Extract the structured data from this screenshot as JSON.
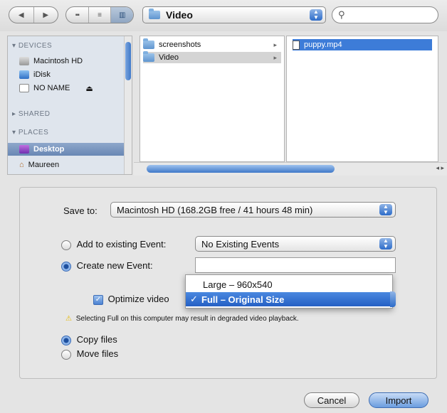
{
  "toolbar": {
    "nav": {
      "back": "◀",
      "forward": "▶"
    },
    "view_modes": [
      "icon",
      "list",
      "column"
    ],
    "location": "Video",
    "search_icon": "⚲"
  },
  "sidebar": {
    "devices_header": "DEVICES",
    "devices": [
      {
        "label": "Macintosh HD",
        "icon": "hard-drive-icon"
      },
      {
        "label": "iDisk",
        "icon": "idisk-icon"
      },
      {
        "label": "NO NAME",
        "icon": "volume-icon",
        "eject": "⏏"
      }
    ],
    "shared_header": "SHARED",
    "places_header": "PLACES",
    "places": [
      {
        "label": "Desktop",
        "icon": "desktop-icon",
        "selected": true
      },
      {
        "label": "Maureen",
        "icon": "home-icon"
      }
    ]
  },
  "browser": {
    "column1": [
      {
        "label": "screenshots",
        "arrow": "▸"
      },
      {
        "label": "Video",
        "arrow": "▸"
      }
    ],
    "column2": [
      {
        "label": "puppy.mp4"
      }
    ]
  },
  "options": {
    "save_to_label": "Save to:",
    "save_to_value": "Macintosh HD (168.2GB free / 41 hours 48 min)",
    "add_existing_label": "Add to existing Event:",
    "add_existing_value": "No Existing Events",
    "create_new_label": "Create new Event:",
    "create_new_value": "",
    "optimize_label": "Optimize video",
    "optimize_menu": [
      {
        "label": "Large – 960x540",
        "checked": false
      },
      {
        "label": "Full – Original Size",
        "checked": true
      }
    ],
    "checkmark": "✓",
    "warning_icon": "⚠",
    "warning_text": "Selecting Full on this computer may result in degraded video playback.",
    "copy_files_label": "Copy files",
    "move_files_label": "Move files"
  },
  "buttons": {
    "cancel": "Cancel",
    "import": "Import"
  },
  "colors": {
    "selection": "#3d7cd8",
    "sidebar_bg": "#dfe5ed",
    "warning": "#e6b800"
  }
}
